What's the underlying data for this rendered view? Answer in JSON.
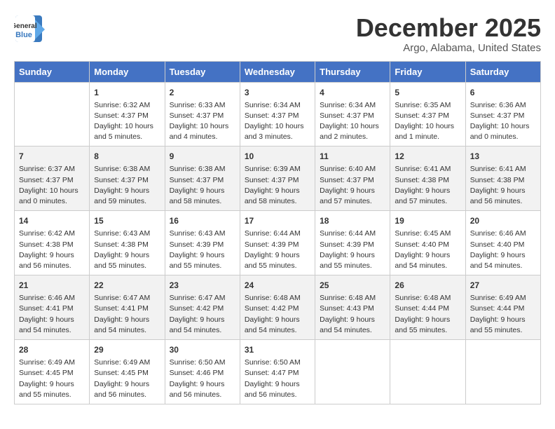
{
  "logo": {
    "general": "General",
    "blue": "Blue"
  },
  "title": "December 2025",
  "location": "Argo, Alabama, United States",
  "days_header": [
    "Sunday",
    "Monday",
    "Tuesday",
    "Wednesday",
    "Thursday",
    "Friday",
    "Saturday"
  ],
  "weeks": [
    [
      {
        "day": "",
        "content": ""
      },
      {
        "day": "1",
        "content": "Sunrise: 6:32 AM\nSunset: 4:37 PM\nDaylight: 10 hours\nand 5 minutes."
      },
      {
        "day": "2",
        "content": "Sunrise: 6:33 AM\nSunset: 4:37 PM\nDaylight: 10 hours\nand 4 minutes."
      },
      {
        "day": "3",
        "content": "Sunrise: 6:34 AM\nSunset: 4:37 PM\nDaylight: 10 hours\nand 3 minutes."
      },
      {
        "day": "4",
        "content": "Sunrise: 6:34 AM\nSunset: 4:37 PM\nDaylight: 10 hours\nand 2 minutes."
      },
      {
        "day": "5",
        "content": "Sunrise: 6:35 AM\nSunset: 4:37 PM\nDaylight: 10 hours\nand 1 minute."
      },
      {
        "day": "6",
        "content": "Sunrise: 6:36 AM\nSunset: 4:37 PM\nDaylight: 10 hours\nand 0 minutes."
      }
    ],
    [
      {
        "day": "7",
        "content": "Sunrise: 6:37 AM\nSunset: 4:37 PM\nDaylight: 10 hours\nand 0 minutes."
      },
      {
        "day": "8",
        "content": "Sunrise: 6:38 AM\nSunset: 4:37 PM\nDaylight: 9 hours\nand 59 minutes."
      },
      {
        "day": "9",
        "content": "Sunrise: 6:38 AM\nSunset: 4:37 PM\nDaylight: 9 hours\nand 58 minutes."
      },
      {
        "day": "10",
        "content": "Sunrise: 6:39 AM\nSunset: 4:37 PM\nDaylight: 9 hours\nand 58 minutes."
      },
      {
        "day": "11",
        "content": "Sunrise: 6:40 AM\nSunset: 4:37 PM\nDaylight: 9 hours\nand 57 minutes."
      },
      {
        "day": "12",
        "content": "Sunrise: 6:41 AM\nSunset: 4:38 PM\nDaylight: 9 hours\nand 57 minutes."
      },
      {
        "day": "13",
        "content": "Sunrise: 6:41 AM\nSunset: 4:38 PM\nDaylight: 9 hours\nand 56 minutes."
      }
    ],
    [
      {
        "day": "14",
        "content": "Sunrise: 6:42 AM\nSunset: 4:38 PM\nDaylight: 9 hours\nand 56 minutes."
      },
      {
        "day": "15",
        "content": "Sunrise: 6:43 AM\nSunset: 4:38 PM\nDaylight: 9 hours\nand 55 minutes."
      },
      {
        "day": "16",
        "content": "Sunrise: 6:43 AM\nSunset: 4:39 PM\nDaylight: 9 hours\nand 55 minutes."
      },
      {
        "day": "17",
        "content": "Sunrise: 6:44 AM\nSunset: 4:39 PM\nDaylight: 9 hours\nand 55 minutes."
      },
      {
        "day": "18",
        "content": "Sunrise: 6:44 AM\nSunset: 4:39 PM\nDaylight: 9 hours\nand 55 minutes."
      },
      {
        "day": "19",
        "content": "Sunrise: 6:45 AM\nSunset: 4:40 PM\nDaylight: 9 hours\nand 54 minutes."
      },
      {
        "day": "20",
        "content": "Sunrise: 6:46 AM\nSunset: 4:40 PM\nDaylight: 9 hours\nand 54 minutes."
      }
    ],
    [
      {
        "day": "21",
        "content": "Sunrise: 6:46 AM\nSunset: 4:41 PM\nDaylight: 9 hours\nand 54 minutes."
      },
      {
        "day": "22",
        "content": "Sunrise: 6:47 AM\nSunset: 4:41 PM\nDaylight: 9 hours\nand 54 minutes."
      },
      {
        "day": "23",
        "content": "Sunrise: 6:47 AM\nSunset: 4:42 PM\nDaylight: 9 hours\nand 54 minutes."
      },
      {
        "day": "24",
        "content": "Sunrise: 6:48 AM\nSunset: 4:42 PM\nDaylight: 9 hours\nand 54 minutes."
      },
      {
        "day": "25",
        "content": "Sunrise: 6:48 AM\nSunset: 4:43 PM\nDaylight: 9 hours\nand 54 minutes."
      },
      {
        "day": "26",
        "content": "Sunrise: 6:48 AM\nSunset: 4:44 PM\nDaylight: 9 hours\nand 55 minutes."
      },
      {
        "day": "27",
        "content": "Sunrise: 6:49 AM\nSunset: 4:44 PM\nDaylight: 9 hours\nand 55 minutes."
      }
    ],
    [
      {
        "day": "28",
        "content": "Sunrise: 6:49 AM\nSunset: 4:45 PM\nDaylight: 9 hours\nand 55 minutes."
      },
      {
        "day": "29",
        "content": "Sunrise: 6:49 AM\nSunset: 4:45 PM\nDaylight: 9 hours\nand 56 minutes."
      },
      {
        "day": "30",
        "content": "Sunrise: 6:50 AM\nSunset: 4:46 PM\nDaylight: 9 hours\nand 56 minutes."
      },
      {
        "day": "31",
        "content": "Sunrise: 6:50 AM\nSunset: 4:47 PM\nDaylight: 9 hours\nand 56 minutes."
      },
      {
        "day": "",
        "content": ""
      },
      {
        "day": "",
        "content": ""
      },
      {
        "day": "",
        "content": ""
      }
    ]
  ]
}
